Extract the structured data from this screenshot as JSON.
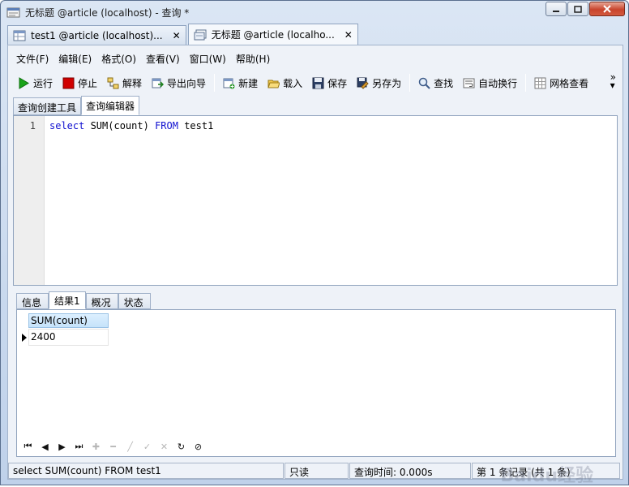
{
  "window": {
    "title": "无标题 @article (localhost) - 查询 *",
    "controls": [
      "minimize",
      "maximize",
      "close"
    ]
  },
  "doc_tabs": [
    {
      "label": "test1 @article (localhost)...",
      "close": "✕",
      "active": false
    },
    {
      "label": "无标题 @article (localho...",
      "close": "✕",
      "active": true
    }
  ],
  "menu": {
    "file": "文件(F)",
    "edit": "编辑(E)",
    "format": "格式(O)",
    "view": "查看(V)",
    "window": "窗口(W)",
    "help": "帮助(H)"
  },
  "toolbar": {
    "run": "运行",
    "stop": "停止",
    "explain": "解释",
    "export_wizard": "导出向导",
    "new": "新建",
    "load": "载入",
    "save": "保存",
    "save_as": "另存为",
    "find": "查找",
    "word_wrap": "自动换行",
    "grid_view": "网格查看",
    "overflow": "»"
  },
  "sub_tabs": {
    "query_builder": "查询创建工具",
    "query_editor": "查询编辑器"
  },
  "editor": {
    "line_number": "1",
    "kw_select": "select",
    "expr": " SUM(count) ",
    "kw_from": "FROM",
    "table": " test1"
  },
  "result_tabs": {
    "info": "信息",
    "result1": "结果1",
    "profile": "概况",
    "status": "状态"
  },
  "grid": {
    "column": "SUM(count)",
    "rows": [
      "2400"
    ]
  },
  "statusbar": {
    "sql": "select SUM(count) FROM test1",
    "readonly": "只读",
    "query_time": "查询时间: 0.000s",
    "record": "第 1 条记录 (共 1 条)"
  },
  "watermark": "Baidu经验",
  "colors": {
    "keyword": "#1010d0",
    "column_header": "#c6e3fa",
    "stop_red": "#d00000",
    "run_green": "#19a319"
  }
}
